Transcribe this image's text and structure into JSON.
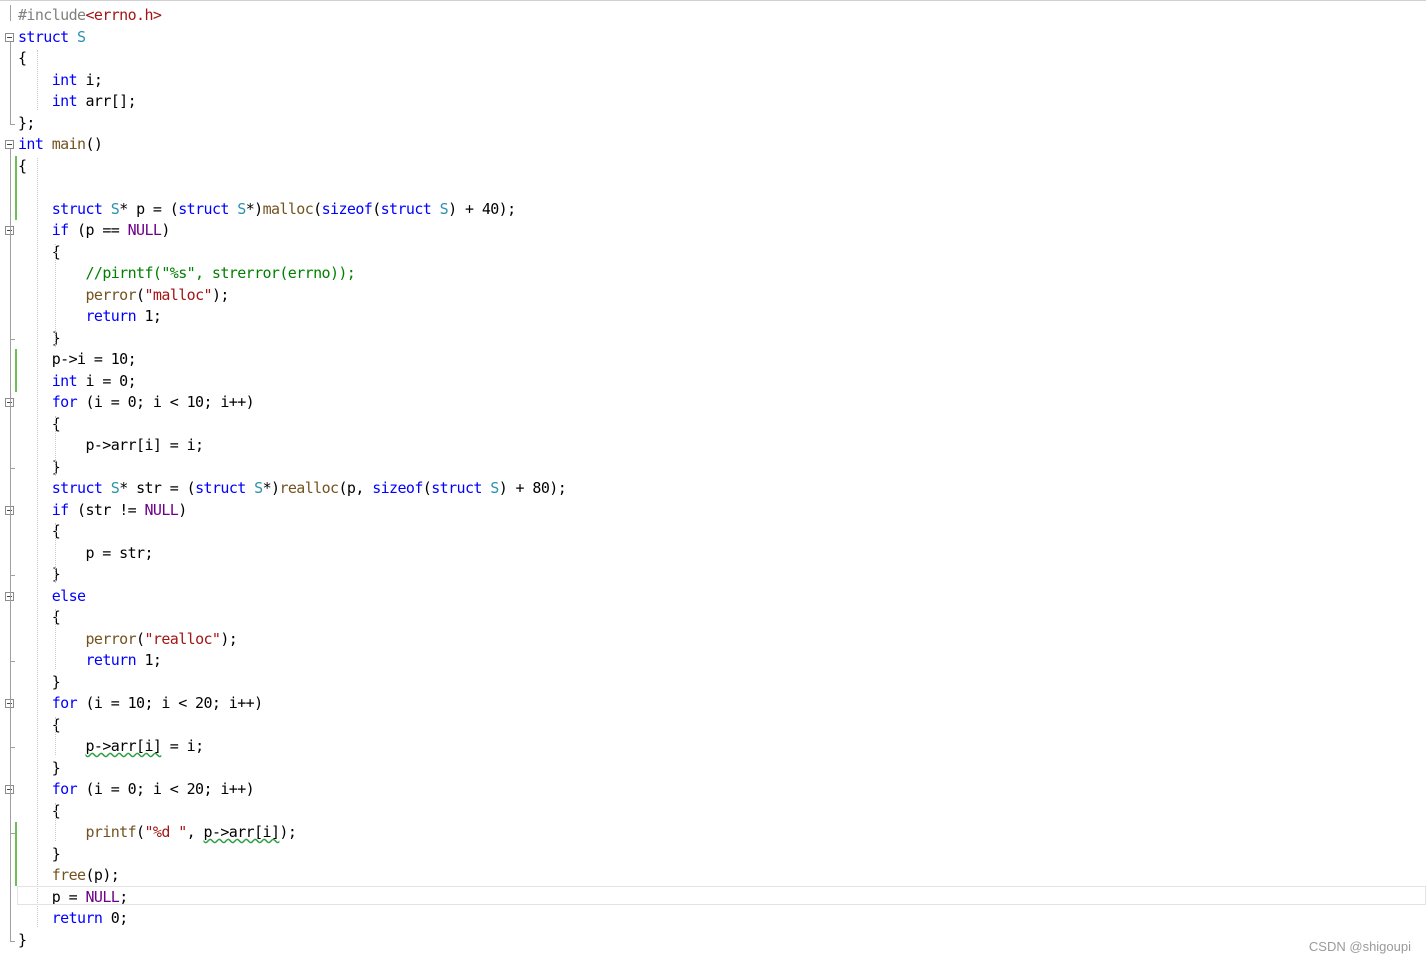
{
  "editor": {
    "lines": [
      [
        [
          "#include",
          "pp"
        ],
        [
          "<errno.h>",
          "str"
        ]
      ],
      [
        [
          "struct",
          "kw"
        ],
        [
          " ",
          ""
        ],
        [
          "S",
          "type"
        ]
      ],
      [
        [
          "{",
          ""
        ]
      ],
      [
        [
          "    ",
          ""
        ],
        [
          "int",
          "kw"
        ],
        [
          " i;",
          ""
        ]
      ],
      [
        [
          "    ",
          ""
        ],
        [
          "int",
          "kw"
        ],
        [
          " arr[];",
          ""
        ]
      ],
      [
        [
          "};",
          ""
        ]
      ],
      [
        [
          "int",
          "kw"
        ],
        [
          " ",
          ""
        ],
        [
          "main",
          "fn"
        ],
        [
          "()",
          ""
        ]
      ],
      [
        [
          "{",
          ""
        ]
      ],
      [
        [
          "",
          ""
        ]
      ],
      [
        [
          "    ",
          ""
        ],
        [
          "struct",
          "kw"
        ],
        [
          " ",
          ""
        ],
        [
          "S",
          "type"
        ],
        [
          "* p = (",
          ""
        ],
        [
          "struct",
          "kw"
        ],
        [
          " ",
          ""
        ],
        [
          "S",
          "type"
        ],
        [
          "*)",
          ""
        ],
        [
          "malloc",
          "fn"
        ],
        [
          "(",
          ""
        ],
        [
          "sizeof",
          "kw"
        ],
        [
          "(",
          ""
        ],
        [
          "struct",
          "kw"
        ],
        [
          " ",
          ""
        ],
        [
          "S",
          "type"
        ],
        [
          ") + 40);",
          ""
        ]
      ],
      [
        [
          "    ",
          ""
        ],
        [
          "if",
          "kw"
        ],
        [
          " (p == ",
          ""
        ],
        [
          "NULL",
          "macro"
        ],
        [
          ")",
          ""
        ]
      ],
      [
        [
          "    {",
          ""
        ]
      ],
      [
        [
          "        ",
          ""
        ],
        [
          "//pirntf(\"%s\", strerror(errno));",
          "com"
        ]
      ],
      [
        [
          "        ",
          ""
        ],
        [
          "perror",
          "fn"
        ],
        [
          "(",
          ""
        ],
        [
          "\"malloc\"",
          "str"
        ],
        [
          ");",
          ""
        ]
      ],
      [
        [
          "        ",
          ""
        ],
        [
          "return",
          "kw"
        ],
        [
          " 1;",
          ""
        ]
      ],
      [
        [
          "    }",
          ""
        ]
      ],
      [
        [
          "    p->i = 10;",
          ""
        ]
      ],
      [
        [
          "    ",
          ""
        ],
        [
          "int",
          "kw"
        ],
        [
          " i = 0;",
          ""
        ]
      ],
      [
        [
          "    ",
          ""
        ],
        [
          "for",
          "kw"
        ],
        [
          " (i = 0; i < 10; i++)",
          ""
        ]
      ],
      [
        [
          "    {",
          ""
        ]
      ],
      [
        [
          "        p->arr[i] = i;",
          ""
        ]
      ],
      [
        [
          "    }",
          ""
        ]
      ],
      [
        [
          "    ",
          ""
        ],
        [
          "struct",
          "kw"
        ],
        [
          " ",
          ""
        ],
        [
          "S",
          "type"
        ],
        [
          "* str = (",
          ""
        ],
        [
          "struct",
          "kw"
        ],
        [
          " ",
          ""
        ],
        [
          "S",
          "type"
        ],
        [
          "*)",
          ""
        ],
        [
          "realloc",
          "fn"
        ],
        [
          "(p, ",
          ""
        ],
        [
          "sizeof",
          "kw"
        ],
        [
          "(",
          ""
        ],
        [
          "struct",
          "kw"
        ],
        [
          " ",
          ""
        ],
        [
          "S",
          "type"
        ],
        [
          ") + 80);",
          ""
        ]
      ],
      [
        [
          "    ",
          ""
        ],
        [
          "if",
          "kw"
        ],
        [
          " (str != ",
          ""
        ],
        [
          "NULL",
          "macro"
        ],
        [
          ")",
          ""
        ]
      ],
      [
        [
          "    {",
          ""
        ]
      ],
      [
        [
          "        p = str;",
          ""
        ]
      ],
      [
        [
          "    }",
          ""
        ]
      ],
      [
        [
          "    ",
          ""
        ],
        [
          "else",
          "kw"
        ]
      ],
      [
        [
          "    {",
          ""
        ]
      ],
      [
        [
          "        ",
          ""
        ],
        [
          "perror",
          "fn"
        ],
        [
          "(",
          ""
        ],
        [
          "\"realloc\"",
          "str"
        ],
        [
          ");",
          ""
        ]
      ],
      [
        [
          "        ",
          ""
        ],
        [
          "return",
          "kw"
        ],
        [
          " 1;",
          ""
        ]
      ],
      [
        [
          "    }",
          ""
        ]
      ],
      [
        [
          "    ",
          ""
        ],
        [
          "for",
          "kw"
        ],
        [
          " (i = 10; i < 20; i++)",
          ""
        ]
      ],
      [
        [
          "    {",
          ""
        ]
      ],
      [
        [
          "        ",
          ""
        ],
        [
          "p->arr[i]",
          "squiggle"
        ],
        [
          " = i;",
          ""
        ]
      ],
      [
        [
          "    }",
          ""
        ]
      ],
      [
        [
          "    ",
          ""
        ],
        [
          "for",
          "kw"
        ],
        [
          " (i = 0; i < 20; i++)",
          ""
        ]
      ],
      [
        [
          "    {",
          ""
        ]
      ],
      [
        [
          "        ",
          ""
        ],
        [
          "printf",
          "fn"
        ],
        [
          "(",
          ""
        ],
        [
          "\"%d \"",
          "str"
        ],
        [
          ", ",
          ""
        ],
        [
          "p->arr[i]",
          "squiggle"
        ],
        [
          ");",
          ""
        ]
      ],
      [
        [
          "    }",
          ""
        ]
      ],
      [
        [
          "    ",
          ""
        ],
        [
          "free",
          "fn"
        ],
        [
          "(p);",
          ""
        ]
      ],
      [
        [
          "    p = ",
          ""
        ],
        [
          "NULL",
          "macro"
        ],
        [
          ";",
          ""
        ]
      ],
      [
        [
          "    ",
          ""
        ],
        [
          "return",
          "kw"
        ],
        [
          " 0;",
          ""
        ]
      ],
      [
        [
          "}",
          ""
        ]
      ]
    ]
  },
  "colors": {
    "keyword": "#0000ff",
    "type": "#2b91af",
    "macro": "#6f008a",
    "string": "#a31515",
    "comment": "#008000",
    "preprocessor": "#808080",
    "function": "#74531f",
    "change_bar": "#6bbf59"
  },
  "watermark": "CSDN @shigoupi"
}
